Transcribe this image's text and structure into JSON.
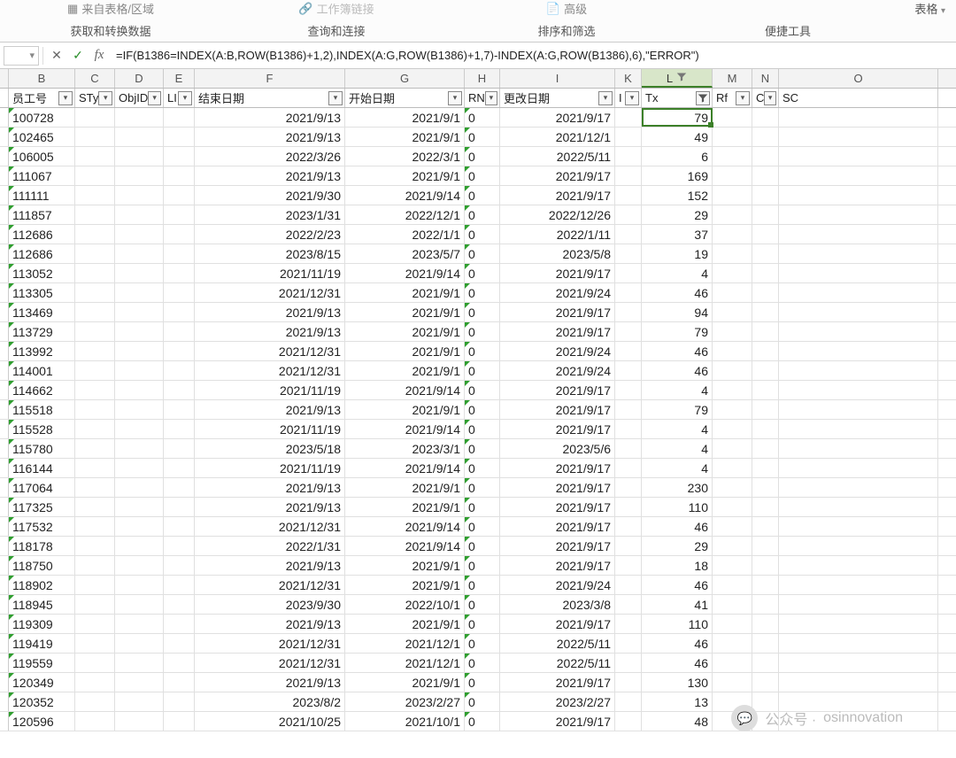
{
  "ribbon": {
    "group1_item": "来自表格/区域",
    "group1_label": "获取和转换数据",
    "group2_item": "工作簿链接",
    "group2_label": "查询和连接",
    "group3_item": "高级",
    "group3_label": "排序和筛选",
    "group4_label": "便捷工具",
    "group5_label": "表格"
  },
  "formula_bar": {
    "formula": "=IF(B1386=INDEX(A:B,ROW(B1386)+1,2),INDEX(A:G,ROW(B1386)+1,7)-INDEX(A:G,ROW(B1386),6),\"ERROR\")"
  },
  "columns": [
    {
      "letter": "B",
      "field": "员工号",
      "cls": "c-B",
      "filter": "arrow"
    },
    {
      "letter": "C",
      "field": "STy",
      "cls": "c-C",
      "filter": "arrow"
    },
    {
      "letter": "D",
      "field": "ObjID",
      "cls": "c-D",
      "filter": "arrow"
    },
    {
      "letter": "E",
      "field": "LI",
      "cls": "c-E",
      "filter": "arrow"
    },
    {
      "letter": "F",
      "field": "结束日期",
      "cls": "c-F",
      "filter": "arrow"
    },
    {
      "letter": "G",
      "field": "开始日期",
      "cls": "c-G",
      "filter": "arrow"
    },
    {
      "letter": "H",
      "field": "RN",
      "cls": "c-H",
      "filter": "arrow"
    },
    {
      "letter": "I",
      "field": "更改日期",
      "cls": "c-I",
      "filter": "arrow"
    },
    {
      "letter": "K",
      "field": "I",
      "cls": "c-K",
      "filter": "arrow"
    },
    {
      "letter": "L",
      "field": "Tx",
      "cls": "c-L",
      "filter": "funnel",
      "selected": true
    },
    {
      "letter": "M",
      "field": "Rf",
      "cls": "c-M",
      "filter": "arrow"
    },
    {
      "letter": "N",
      "field": "C",
      "cls": "c-N",
      "filter": "arrow"
    },
    {
      "letter": "O",
      "field": "SC",
      "cls": "c-O",
      "filter": "none"
    }
  ],
  "rows": [
    {
      "id": "100728",
      "end": "2021/9/13",
      "start": "2021/9/1",
      "rn": "0",
      "chg": "2021/9/17",
      "tx": "79"
    },
    {
      "id": "102465",
      "end": "2021/9/13",
      "start": "2021/9/1",
      "rn": "0",
      "chg": "2021/12/1",
      "tx": "49"
    },
    {
      "id": "106005",
      "end": "2022/3/26",
      "start": "2022/3/1",
      "rn": "0",
      "chg": "2022/5/11",
      "tx": "6"
    },
    {
      "id": "111067",
      "end": "2021/9/13",
      "start": "2021/9/1",
      "rn": "0",
      "chg": "2021/9/17",
      "tx": "169"
    },
    {
      "id": "111111",
      "end": "2021/9/30",
      "start": "2021/9/14",
      "rn": "0",
      "chg": "2021/9/17",
      "tx": "152"
    },
    {
      "id": "111857",
      "end": "2023/1/31",
      "start": "2022/12/1",
      "rn": "0",
      "chg": "2022/12/26",
      "tx": "29"
    },
    {
      "id": "112686",
      "end": "2022/2/23",
      "start": "2022/1/1",
      "rn": "0",
      "chg": "2022/1/11",
      "tx": "37"
    },
    {
      "id": "112686",
      "end": "2023/8/15",
      "start": "2023/5/7",
      "rn": "0",
      "chg": "2023/5/8",
      "tx": "19"
    },
    {
      "id": "113052",
      "end": "2021/11/19",
      "start": "2021/9/14",
      "rn": "0",
      "chg": "2021/9/17",
      "tx": "4"
    },
    {
      "id": "113305",
      "end": "2021/12/31",
      "start": "2021/9/1",
      "rn": "0",
      "chg": "2021/9/24",
      "tx": "46"
    },
    {
      "id": "113469",
      "end": "2021/9/13",
      "start": "2021/9/1",
      "rn": "0",
      "chg": "2021/9/17",
      "tx": "94"
    },
    {
      "id": "113729",
      "end": "2021/9/13",
      "start": "2021/9/1",
      "rn": "0",
      "chg": "2021/9/17",
      "tx": "79"
    },
    {
      "id": "113992",
      "end": "2021/12/31",
      "start": "2021/9/1",
      "rn": "0",
      "chg": "2021/9/24",
      "tx": "46"
    },
    {
      "id": "114001",
      "end": "2021/12/31",
      "start": "2021/9/1",
      "rn": "0",
      "chg": "2021/9/24",
      "tx": "46"
    },
    {
      "id": "114662",
      "end": "2021/11/19",
      "start": "2021/9/14",
      "rn": "0",
      "chg": "2021/9/17",
      "tx": "4"
    },
    {
      "id": "115518",
      "end": "2021/9/13",
      "start": "2021/9/1",
      "rn": "0",
      "chg": "2021/9/17",
      "tx": "79"
    },
    {
      "id": "115528",
      "end": "2021/11/19",
      "start": "2021/9/14",
      "rn": "0",
      "chg": "2021/9/17",
      "tx": "4"
    },
    {
      "id": "115780",
      "end": "2023/5/18",
      "start": "2023/3/1",
      "rn": "0",
      "chg": "2023/5/6",
      "tx": "4"
    },
    {
      "id": "116144",
      "end": "2021/11/19",
      "start": "2021/9/14",
      "rn": "0",
      "chg": "2021/9/17",
      "tx": "4"
    },
    {
      "id": "117064",
      "end": "2021/9/13",
      "start": "2021/9/1",
      "rn": "0",
      "chg": "2021/9/17",
      "tx": "230"
    },
    {
      "id": "117325",
      "end": "2021/9/13",
      "start": "2021/9/1",
      "rn": "0",
      "chg": "2021/9/17",
      "tx": "110"
    },
    {
      "id": "117532",
      "end": "2021/12/31",
      "start": "2021/9/14",
      "rn": "0",
      "chg": "2021/9/17",
      "tx": "46"
    },
    {
      "id": "118178",
      "end": "2022/1/31",
      "start": "2021/9/14",
      "rn": "0",
      "chg": "2021/9/17",
      "tx": "29"
    },
    {
      "id": "118750",
      "end": "2021/9/13",
      "start": "2021/9/1",
      "rn": "0",
      "chg": "2021/9/17",
      "tx": "18"
    },
    {
      "id": "118902",
      "end": "2021/12/31",
      "start": "2021/9/1",
      "rn": "0",
      "chg": "2021/9/24",
      "tx": "46"
    },
    {
      "id": "118945",
      "end": "2023/9/30",
      "start": "2022/10/1",
      "rn": "0",
      "chg": "2023/3/8",
      "tx": "41"
    },
    {
      "id": "119309",
      "end": "2021/9/13",
      "start": "2021/9/1",
      "rn": "0",
      "chg": "2021/9/17",
      "tx": "110"
    },
    {
      "id": "119419",
      "end": "2021/12/31",
      "start": "2021/12/1",
      "rn": "0",
      "chg": "2022/5/11",
      "tx": "46"
    },
    {
      "id": "119559",
      "end": "2021/12/31",
      "start": "2021/12/1",
      "rn": "0",
      "chg": "2022/5/11",
      "tx": "46"
    },
    {
      "id": "120349",
      "end": "2021/9/13",
      "start": "2021/9/1",
      "rn": "0",
      "chg": "2021/9/17",
      "tx": "130"
    },
    {
      "id": "120352",
      "end": "2023/8/2",
      "start": "2023/2/27",
      "rn": "0",
      "chg": "2023/2/27",
      "tx": "13"
    },
    {
      "id": "120596",
      "end": "2021/10/25",
      "start": "2021/10/1",
      "rn": "0",
      "chg": "2021/9/17",
      "tx": "48"
    }
  ],
  "watermark": {
    "prefix": "公众号 ·",
    "name": "osinnovation"
  }
}
